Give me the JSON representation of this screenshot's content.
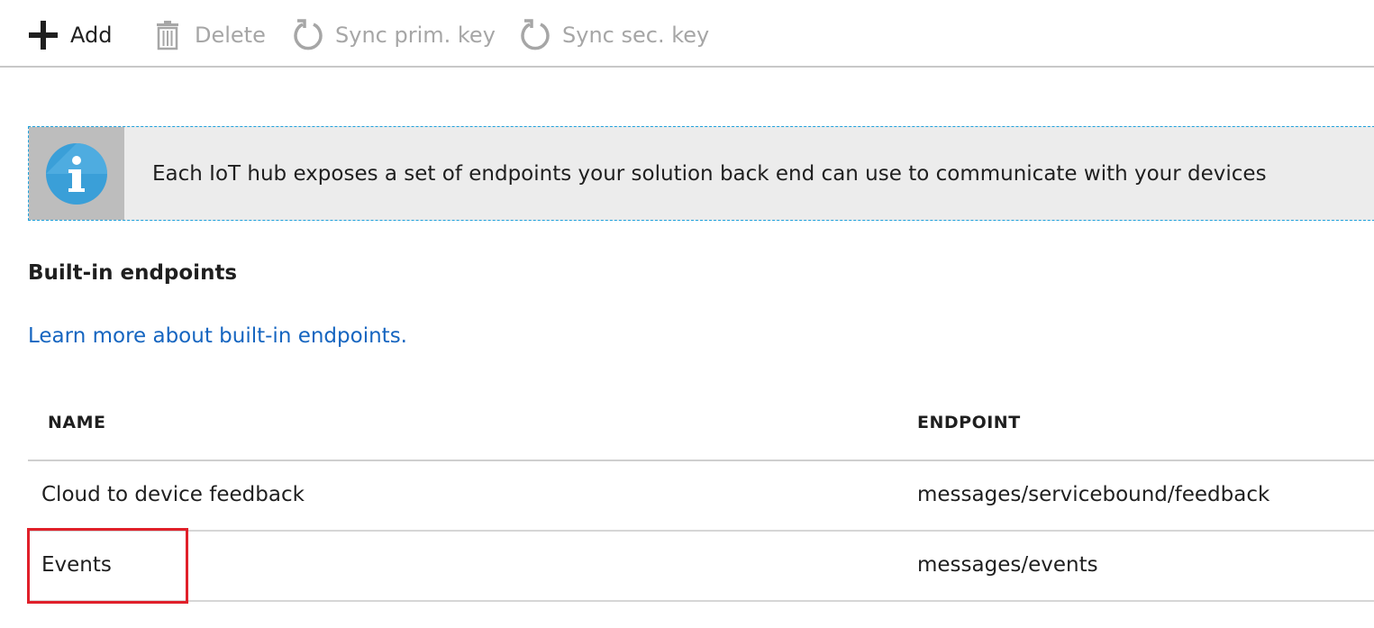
{
  "toolbar": {
    "add_label": "Add",
    "delete_label": "Delete",
    "sync_prim_label": "Sync prim. key",
    "sync_sec_label": "Sync sec. key"
  },
  "info_banner": {
    "text": "Each IoT hub exposes a set of endpoints your solution back end can use to communicate with your devices",
    "icon": "info-icon",
    "border_color": "#1fa1dc",
    "icon_color": "#3a9fd8"
  },
  "section": {
    "title": "Built-in endpoints",
    "learn_more": "Learn more about built-in endpoints."
  },
  "table": {
    "columns": [
      "NAME",
      "ENDPOINT"
    ],
    "rows": [
      {
        "name": "Cloud to device feedback",
        "endpoint": "messages/servicebound/feedback"
      },
      {
        "name": "Events",
        "endpoint": "messages/events"
      }
    ]
  },
  "highlight": {
    "target": "Events",
    "color": "#e0202a"
  }
}
